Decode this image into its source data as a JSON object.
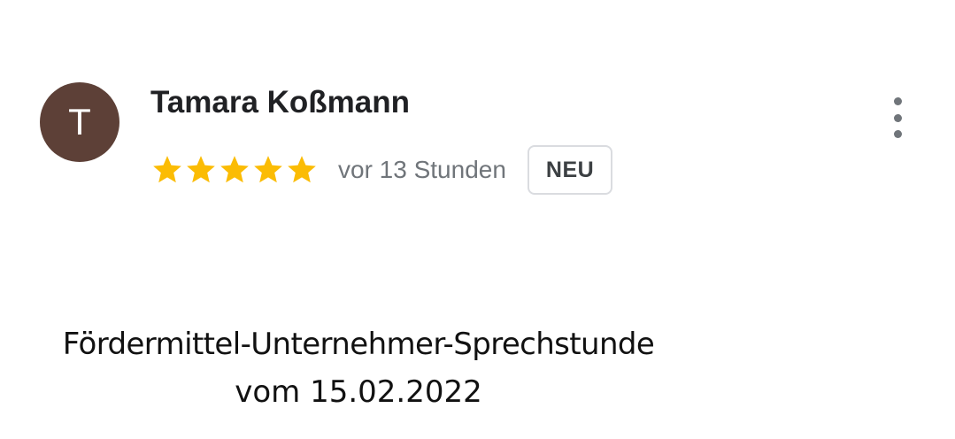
{
  "review": {
    "avatar_initial": "T",
    "author_name": "Tamara Koßmann",
    "rating": 5,
    "rating_max": 5,
    "time_ago": "vor 13 Stunden",
    "badge": "NEU"
  },
  "caption": {
    "line1": "Fördermittel-Unternehmer-Sprechstunde",
    "line2": "vom 15.02.2022"
  },
  "colors": {
    "avatar_bg": "#5d4037",
    "star": "#fbbc04",
    "secondary_text": "#70757a",
    "badge_border": "#dadce0"
  },
  "icons": {
    "star": "star-icon",
    "more": "more-vertical-icon"
  }
}
